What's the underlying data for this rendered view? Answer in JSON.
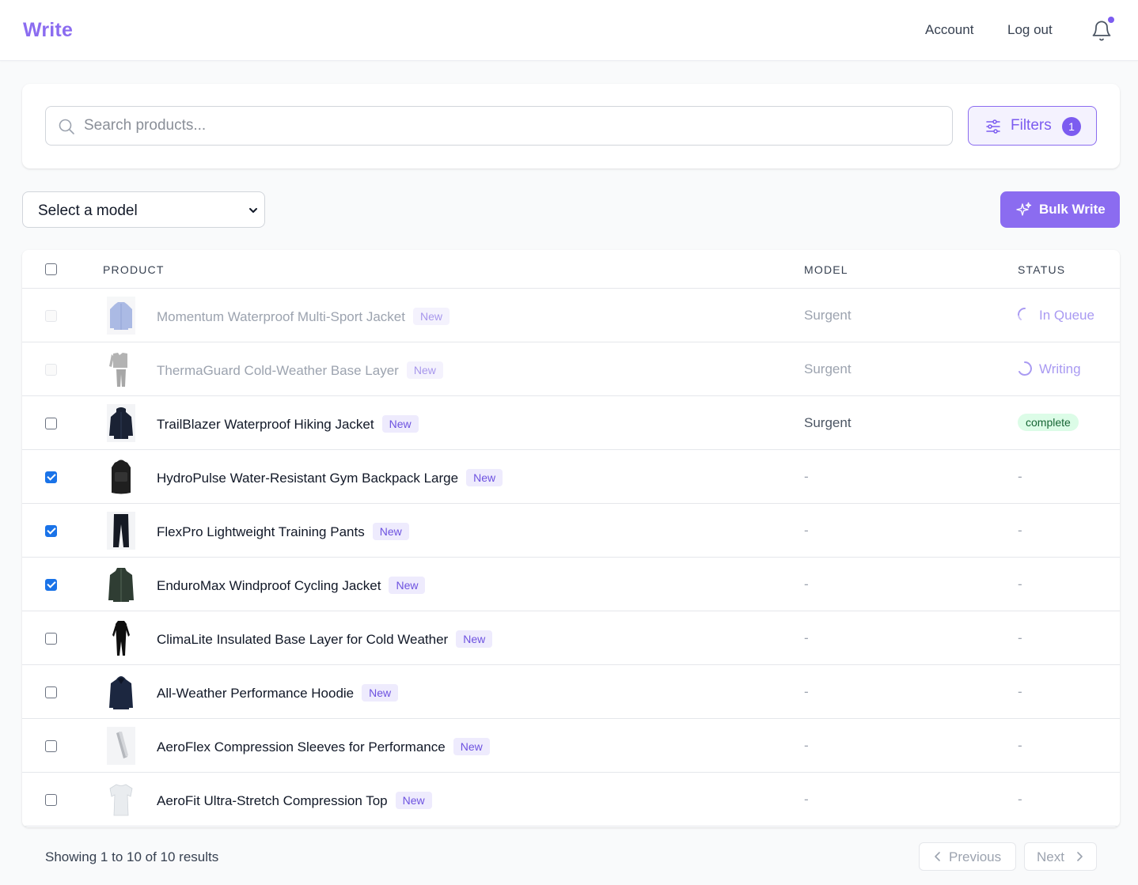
{
  "app": {
    "brand": "Write"
  },
  "nav": {
    "account": "Account",
    "logout": "Log out"
  },
  "colors": {
    "accent": "#8b6cf0",
    "complete_bg": "#dcfce7",
    "complete_fg": "#166534"
  },
  "search": {
    "placeholder": "Search products...",
    "value": ""
  },
  "filters": {
    "label": "Filters",
    "count": "1"
  },
  "model_select": {
    "label": "Select a model",
    "options": [
      "Select a model"
    ]
  },
  "bulk": {
    "label": "Bulk Write"
  },
  "table": {
    "headers": {
      "product": "PRODUCT",
      "model": "MODEL",
      "status": "STATUS"
    },
    "rows": [
      {
        "name": "Momentum Waterproof Multi-Sport Jacket",
        "badge": "New",
        "model": "Surgent",
        "status": "In Queue",
        "checked": false,
        "disabled": true,
        "thumb": "jacket-light-blue"
      },
      {
        "name": "ThermaGuard Cold-Weather Base Layer",
        "badge": "New",
        "model": "Surgent",
        "status": "Writing",
        "checked": false,
        "disabled": true,
        "thumb": "base-layer-grey"
      },
      {
        "name": "TrailBlazer Waterproof Hiking Jacket",
        "badge": "New",
        "model": "Surgent",
        "status": "complete",
        "checked": false,
        "disabled": false,
        "thumb": "jacket-navy"
      },
      {
        "name": "HydroPulse Water-Resistant Gym Backpack Large",
        "badge": "New",
        "model": "-",
        "status": "-",
        "checked": true,
        "disabled": false,
        "thumb": "backpack-black"
      },
      {
        "name": "FlexPro Lightweight Training Pants",
        "badge": "New",
        "model": "-",
        "status": "-",
        "checked": true,
        "disabled": false,
        "thumb": "pants-black"
      },
      {
        "name": "EnduroMax Windproof Cycling Jacket",
        "badge": "New",
        "model": "-",
        "status": "-",
        "checked": true,
        "disabled": false,
        "thumb": "jacket-green"
      },
      {
        "name": "ClimaLite Insulated Base Layer for Cold Weather",
        "badge": "New",
        "model": "-",
        "status": "-",
        "checked": false,
        "disabled": false,
        "thumb": "base-layer-black"
      },
      {
        "name": "All-Weather Performance Hoodie",
        "badge": "New",
        "model": "-",
        "status": "-",
        "checked": false,
        "disabled": false,
        "thumb": "hoodie-navy"
      },
      {
        "name": "AeroFlex Compression Sleeves for Performance",
        "badge": "New",
        "model": "-",
        "status": "-",
        "checked": false,
        "disabled": false,
        "thumb": "sleeve-grey"
      },
      {
        "name": "AeroFit Ultra-Stretch Compression Top",
        "badge": "New",
        "model": "-",
        "status": "-",
        "checked": false,
        "disabled": false,
        "thumb": "top-white"
      }
    ]
  },
  "pagination": {
    "showing": "Showing 1 to 10 of 10 results",
    "previous": "Previous",
    "next": "Next"
  }
}
